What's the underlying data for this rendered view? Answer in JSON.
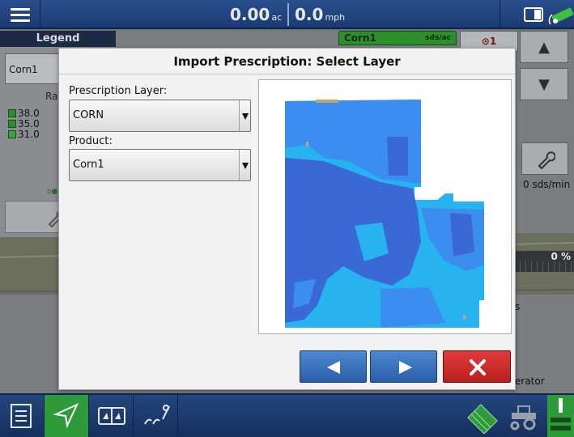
{
  "topbar": {
    "area_value": "0.00",
    "area_unit": "ac",
    "speed_value": "0.0",
    "speed_unit": "mph",
    "icons": [
      "menu-icon",
      "screen-toggle-icon",
      "gps-signal-icon"
    ]
  },
  "background": {
    "legend_tab": "Legend",
    "legend_product": "Corn1",
    "legend_heading_fragment": "Ra",
    "legend_rates": [
      "38.0",
      "35.0",
      "31.0"
    ],
    "product_tab_name": "Corn1",
    "product_tab_unit": "sds/ac",
    "target_count": "1",
    "rate_readout": "0 sds/min",
    "progress_percent": "0 %",
    "progress_value": 0,
    "side_text_fragment": "s",
    "side_text_fragment2": "erator"
  },
  "dialog": {
    "title": "Import Prescription: Select Layer",
    "prescription_layer_label": "Prescription Layer:",
    "prescription_layer_value": "CORN",
    "product_label": "Product:",
    "product_value": "Corn1"
  },
  "colors": {
    "topbar": "#1f427e",
    "dialog_bg": "#f2f2f2",
    "nav_button": "#3a72bc",
    "cancel_button": "#cc2a2a",
    "zone_dark": "#3a68d4",
    "zone_mid": "#3b8ef0",
    "zone_light": "#27b3f0",
    "active_nav": "#2f9a3a"
  },
  "bottombar": {
    "icons": [
      "document-icon",
      "navigation-icon",
      "split-screen-icon",
      "planter-icon",
      "field-map-icon",
      "tractor-icon",
      "implement-icon"
    ]
  }
}
